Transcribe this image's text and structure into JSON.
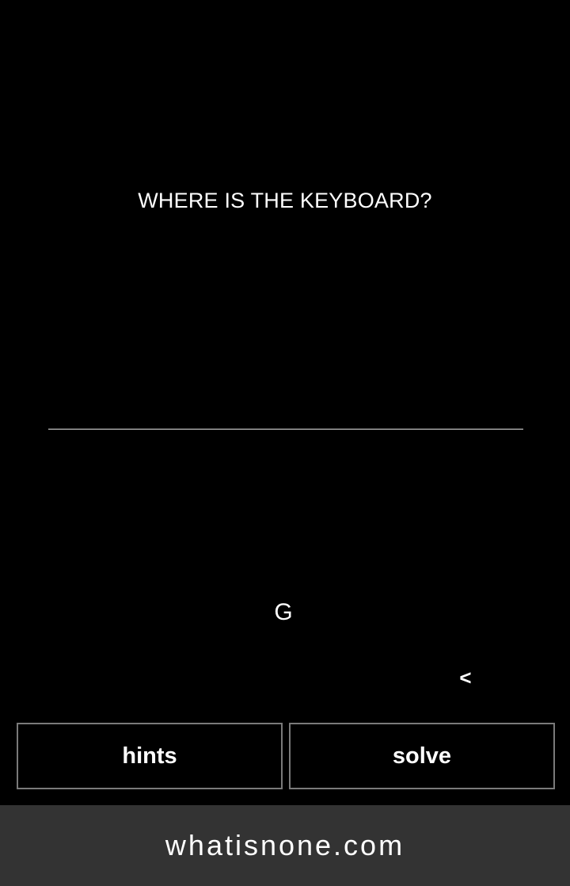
{
  "question": {
    "text": "WHERE IS THE KEYBOARD?"
  },
  "answer": {
    "value": ""
  },
  "keys": {
    "letter": "G",
    "backspace": "<"
  },
  "buttons": {
    "hints_label": "hints",
    "solve_label": "solve"
  },
  "footer": {
    "site": "whatisnone.com"
  },
  "colors": {
    "background": "#000000",
    "text": "#ffffff",
    "button_border": "#7a7a7a",
    "footer_background": "#333333"
  }
}
